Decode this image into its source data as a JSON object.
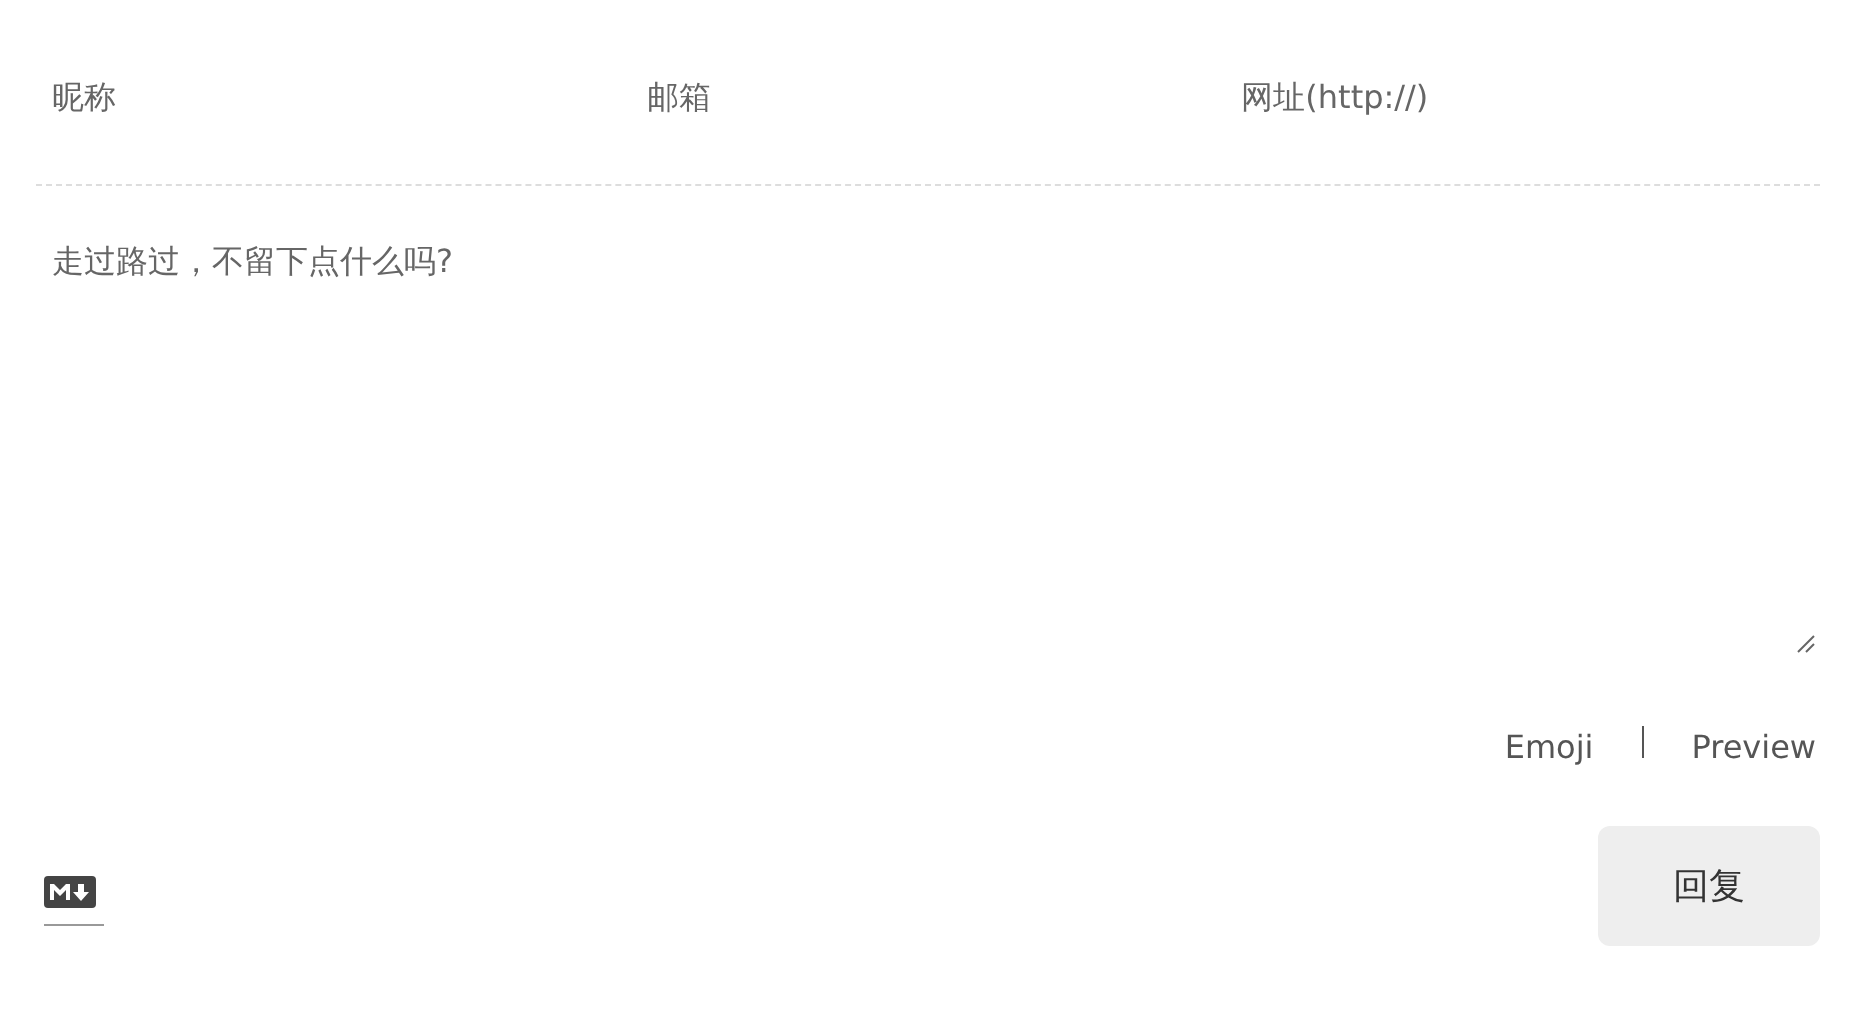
{
  "fields": [
    {
      "placeholder": "昵称"
    },
    {
      "placeholder": "邮箱"
    },
    {
      "placeholder": "网址(http://)"
    }
  ],
  "comment": {
    "placeholder": "走过路过，不留下点什么吗?"
  },
  "actions": [
    "Emoji",
    "Preview"
  ],
  "submit": "回复"
}
